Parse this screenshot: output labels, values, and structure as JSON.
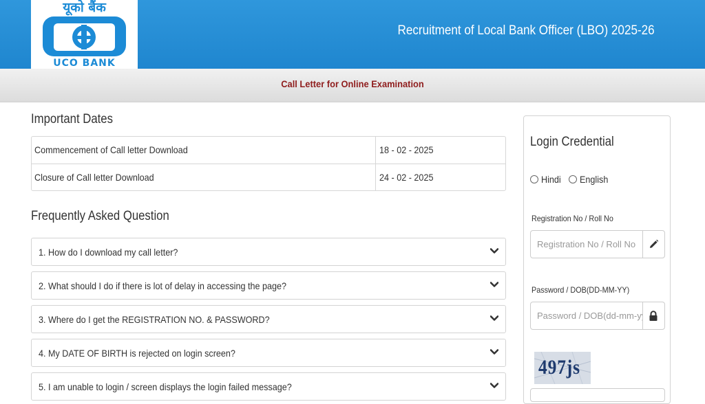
{
  "header": {
    "logo_hindi": "यूको बैंक",
    "logo_english": "UCO BANK",
    "title": "Recruitment of Local Bank Officer (LBO) 2025-26"
  },
  "subheader": {
    "title": "Call Letter for Online Examination"
  },
  "important_dates": {
    "title": "Important Dates",
    "rows": [
      {
        "label": "Commencement of Call letter Download",
        "value": "18 - 02 - 2025"
      },
      {
        "label": "Closure of Call letter Download",
        "value": "24 - 02 - 2025"
      }
    ]
  },
  "faq": {
    "title": "Frequently Asked Question",
    "items": [
      "1. How do I download my call letter?",
      "2. What should I do if there is lot of delay in accessing the page?",
      "3. Where do I get the REGISTRATION NO. & PASSWORD?",
      "4. My DATE OF BIRTH is rejected on login screen?",
      "5. I am unable to login / screen displays the login failed message?"
    ]
  },
  "login": {
    "title": "Login Credential",
    "languages": [
      "Hindi",
      "English"
    ],
    "registration": {
      "label": "Registration No / Roll No",
      "placeholder": "Registration No / Roll No",
      "icon": "pencil-icon"
    },
    "password": {
      "label": "Password / DOB(DD-MM-YY)",
      "placeholder": "Password / DOB(dd-mm-yy)",
      "icon": "lock-icon"
    },
    "captcha_text": "497js"
  },
  "colors": {
    "header_blue": "#2a92d8",
    "subheader_text": "#8f1d1d",
    "logo_blue": "#1c8bd6"
  }
}
